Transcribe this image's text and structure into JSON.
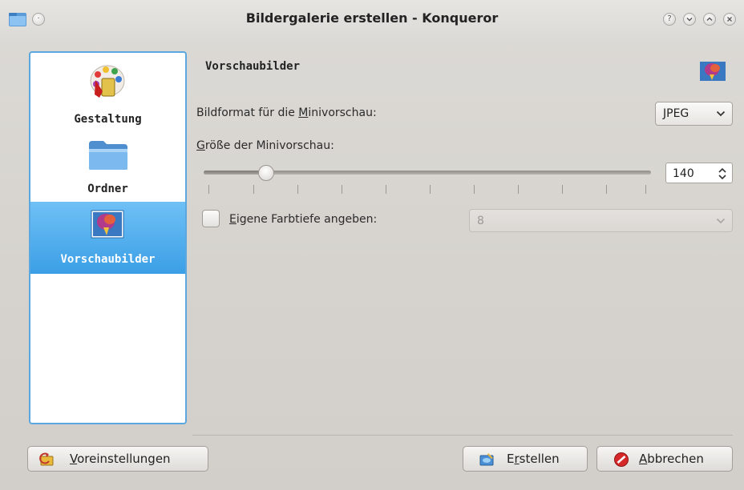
{
  "window": {
    "title": "Bildergalerie erstellen - Konqueror",
    "controls": {
      "help": "?",
      "minimize": "⌄",
      "maximize": "⌃",
      "close": "✕"
    }
  },
  "sidebar": {
    "items": [
      {
        "label": "Gestaltung",
        "icon": "palette-paint-icon",
        "selected": false
      },
      {
        "label": "Ordner",
        "icon": "folder-icon",
        "selected": false
      },
      {
        "label": "Vorschaubilder",
        "icon": "image-thumbnail-icon",
        "selected": true
      }
    ]
  },
  "page": {
    "title": "Vorschaubilder",
    "format_label_pre": "Bildformat für die ",
    "format_label_key": "M",
    "format_label_post": "inivorschau:",
    "format_value": "JPEG",
    "size_label_key": "G",
    "size_label_post": "röße der Minivorschau:",
    "size_value": "140",
    "depth_label_key": "E",
    "depth_label_post": "igene Farbtiefe angeben:",
    "depth_checked": false,
    "depth_value": "8",
    "depth_enabled": false
  },
  "buttons": {
    "defaults_key": "V",
    "defaults_post": "oreinstellungen",
    "create_pre": "E",
    "create_key": "r",
    "create_post": "stellen",
    "cancel_key": "A",
    "cancel_post": "bbrechen"
  },
  "colors": {
    "accent": "#3b9fe6",
    "sidebar_border": "#5aa8df",
    "window_bg": "#d6d3ce"
  }
}
